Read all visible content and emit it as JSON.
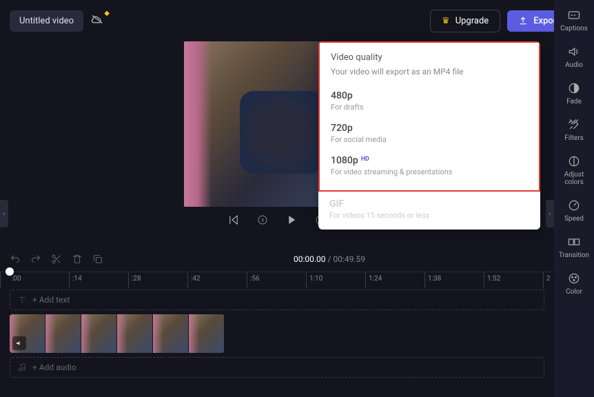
{
  "header": {
    "title": "Untitled video",
    "upgrade_label": "Upgrade",
    "export_label": "Export"
  },
  "export_dropdown": {
    "title": "Video quality",
    "subtitle": "Your video will export as an MP4 file",
    "options": [
      {
        "label": "480p",
        "desc": "For drafts",
        "badge": ""
      },
      {
        "label": "720p",
        "desc": "For social media",
        "badge": ""
      },
      {
        "label": "1080p",
        "desc": "For video streaming & presentations",
        "badge": "HD"
      }
    ],
    "gif": {
      "label": "GIF",
      "desc": "For videos 15 seconds or less"
    }
  },
  "sidebar": {
    "items": [
      {
        "label": "Captions"
      },
      {
        "label": "Audio"
      },
      {
        "label": "Fade"
      },
      {
        "label": "Filters"
      },
      {
        "label": "Adjust colors"
      },
      {
        "label": "Speed"
      },
      {
        "label": "Transition"
      },
      {
        "label": "Color"
      }
    ]
  },
  "timeline": {
    "current": "00:00.00",
    "duration": "00:49.59",
    "ticks": [
      ":00",
      ":14",
      ":28",
      ":42",
      ":56",
      "1:10",
      "1:24",
      "1:38",
      "1:52",
      "2"
    ],
    "add_text": "+ Add text",
    "add_audio": "+ Add audio"
  }
}
